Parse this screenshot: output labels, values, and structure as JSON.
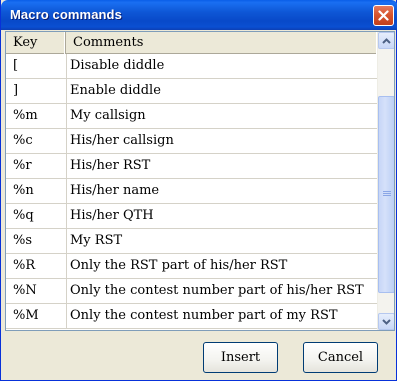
{
  "window": {
    "title": "Macro commands"
  },
  "list": {
    "columns": {
      "key": "Key",
      "comments": "Comments"
    },
    "rows": [
      {
        "key": "[",
        "comment": "Disable diddle"
      },
      {
        "key": "]",
        "comment": "Enable diddle"
      },
      {
        "key": "%m",
        "comment": "My callsign"
      },
      {
        "key": "%c",
        "comment": "His/her callsign"
      },
      {
        "key": "%r",
        "comment": "His/her RST"
      },
      {
        "key": "%n",
        "comment": "His/her name"
      },
      {
        "key": "%q",
        "comment": "His/her QTH"
      },
      {
        "key": "%s",
        "comment": "My RST"
      },
      {
        "key": "%R",
        "comment": "Only the RST part of his/her RST"
      },
      {
        "key": "%N",
        "comment": "Only the contest number part of his/her RST"
      },
      {
        "key": "%M",
        "comment": "Only the contest number part of my RST"
      }
    ]
  },
  "buttons": {
    "insert": "Insert",
    "cancel": "Cancel"
  },
  "icons": {
    "close": "close-icon",
    "scroll_up": "arrow-up-icon",
    "scroll_down": "arrow-down-icon"
  },
  "colors": {
    "titlebar": "#0a4fd2",
    "close": "#d8552e",
    "dialog_bg": "#ece9d8"
  }
}
